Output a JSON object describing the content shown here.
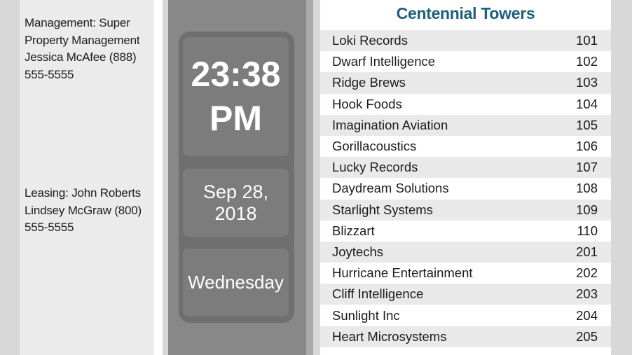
{
  "contacts": {
    "management": {
      "line1": "Management: Super",
      "line2": "Property Management",
      "line3": "Jessica McAfee (888)",
      "line4": "555-5555"
    },
    "leasing": {
      "line1": "Leasing: John Roberts",
      "line2": "Lindsey McGraw (800)",
      "line3": "555-5555"
    }
  },
  "clock": {
    "time": "23:38",
    "meridiem": "PM",
    "date": "Sep 28, 2018",
    "weekday": "Wednesday"
  },
  "directory": {
    "title": "Centennial Towers",
    "title_color": "#1d5f7c",
    "entries": [
      {
        "name": "Loki Records",
        "suite": "101"
      },
      {
        "name": "Dwarf Intelligence",
        "suite": "102"
      },
      {
        "name": "Ridge Brews",
        "suite": "103"
      },
      {
        "name": "Hook Foods",
        "suite": "104"
      },
      {
        "name": "Imagination Aviation",
        "suite": "105"
      },
      {
        "name": "Gorillacoustics",
        "suite": "106"
      },
      {
        "name": "Lucky Records",
        "suite": "107"
      },
      {
        "name": "Daydream Solutions",
        "suite": "108"
      },
      {
        "name": "Starlight Systems",
        "suite": "109"
      },
      {
        "name": "Blizzart",
        "suite": "110"
      },
      {
        "name": "Joytechs",
        "suite": "201"
      },
      {
        "name": "Hurricane Entertainment",
        "suite": "202"
      },
      {
        "name": "Cliff Intelligence",
        "suite": "203"
      },
      {
        "name": "Sunlight Inc",
        "suite": "204"
      },
      {
        "name": "Heart Microsystems",
        "suite": "205"
      }
    ]
  }
}
